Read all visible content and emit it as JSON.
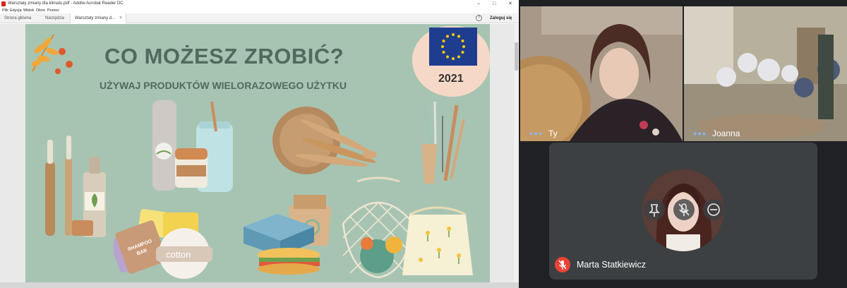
{
  "acrobat": {
    "window_title": "Warsztaty zmiany dla klimatu.pdf - Adobe Acrobat Reader DC",
    "menu": [
      "Plik",
      "Edycja",
      "Widok",
      "Okno",
      "Pomoc"
    ],
    "tabs": {
      "home": "Strona główna",
      "tools": "Narzędzia",
      "document": "Warsztaty zmiany d...",
      "document_close": "×",
      "help": "?",
      "sign_in": "Zaloguj się"
    },
    "window_controls": {
      "minimize": "–",
      "maximize": "□",
      "close": "✕"
    }
  },
  "slide": {
    "title": "CO MOŻESZ ZROBIĆ?",
    "subtitle": "UŻYWAJ PRODUKTÓW WIELORAZOWEGO UŻYTKU",
    "year": "2021",
    "soap_label_1": "SHAMPOO",
    "soap_label_2": "BAR",
    "cotton_label": "cotton",
    "colors": {
      "background": "#a7c4b2",
      "title": "#506a5e",
      "eu_blue": "#1f3d8f",
      "eu_star": "#ffcc00",
      "peach": "#f5d9c6"
    }
  },
  "meet": {
    "participants": [
      {
        "name": "Ty",
        "speaking_indicator": "●●●"
      },
      {
        "name": "Joanna",
        "speaking_indicator": "●●●"
      },
      {
        "name": "Marta Statkiewicz",
        "mic": "muted"
      }
    ],
    "controls": {
      "pin_icon": "pin-icon",
      "mute_icon": "mic-off-icon",
      "remove_icon": "remove-icon"
    },
    "colors": {
      "background": "#202124",
      "tile": "#3c4043",
      "mic_off": "#ea4335",
      "indicator": "#8ab4f8"
    }
  }
}
